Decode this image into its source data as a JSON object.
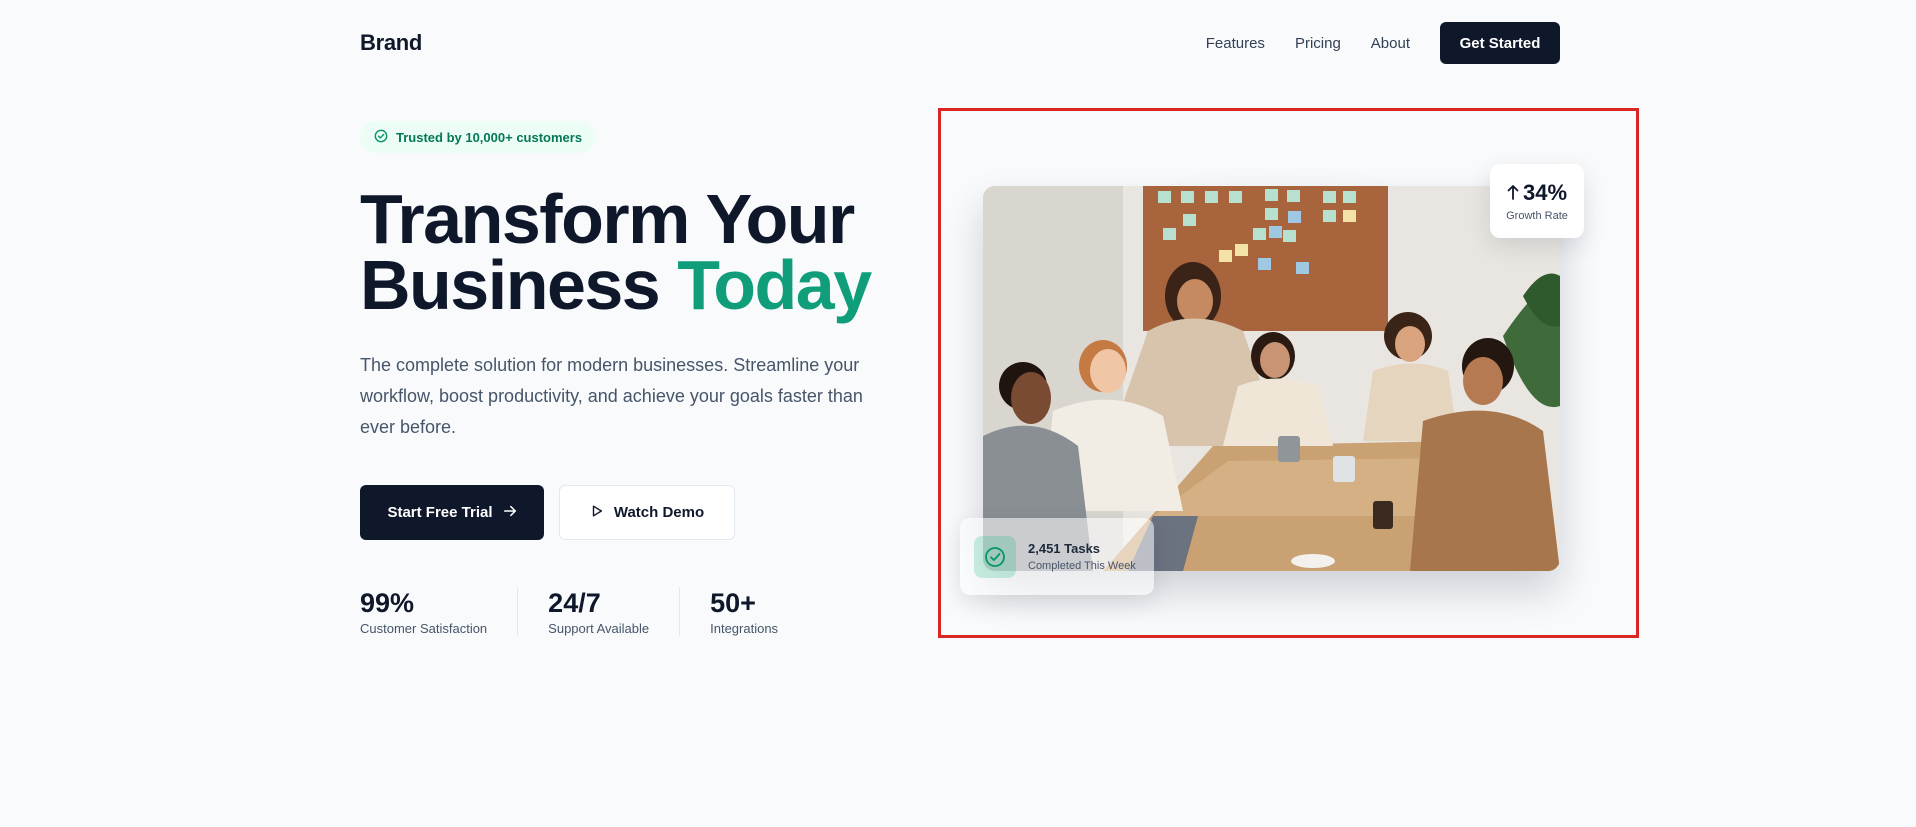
{
  "nav": {
    "brand": "Brand",
    "links": [
      "Features",
      "Pricing",
      "About"
    ],
    "cta": "Get Started"
  },
  "hero": {
    "badge": "Trusted by 10,000+ customers",
    "headline_line1": "Transform Your",
    "headline_line2_main": "Business",
    "headline_line2_accent": "Today",
    "subtext": "The complete solution for modern businesses. Streamline your workflow, boost productivity, and achieve your goals faster than ever before.",
    "primary_button": "Start Free Trial",
    "secondary_button": "Watch Demo",
    "stats": [
      {
        "value": "99%",
        "label": "Customer Satisfaction"
      },
      {
        "value": "24/7",
        "label": "Support Available"
      },
      {
        "value": "50+",
        "label": "Integrations"
      }
    ]
  },
  "visual": {
    "growth_value": "34%",
    "growth_label": "Growth Rate",
    "tasks_title": "2,451 Tasks",
    "tasks_sub": "Completed This Week"
  },
  "colors": {
    "primary": "#0f172a",
    "accent": "#0f9d7a",
    "highlight_frame": "#dc2626"
  },
  "icons": {
    "badge": "check-circle-icon",
    "primary_button": "arrow-right-icon",
    "secondary_button": "play-icon",
    "growth": "arrow-up-icon",
    "tasks": "check-circle-icon"
  }
}
